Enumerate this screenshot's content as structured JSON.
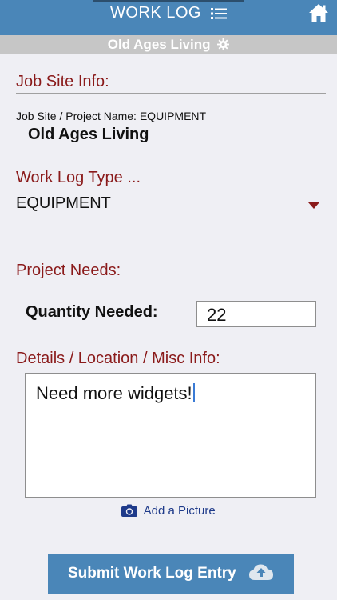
{
  "header": {
    "title": "WORK LOG",
    "subtitle": "Old Ages Living"
  },
  "job_site": {
    "section_title": "Job Site Info:",
    "label": "Job Site / Project Name: EQUIPMENT",
    "project_name": "Old Ages Living"
  },
  "work_log_type": {
    "section_title": "Work Log Type ...",
    "selected": "EQUIPMENT"
  },
  "project_needs": {
    "section_title": "Project Needs:",
    "quantity_label": "Quantity Needed:",
    "quantity_value": "22"
  },
  "details": {
    "section_title": "Details / Location / Misc Info:",
    "value": "Need more widgets!"
  },
  "actions": {
    "add_picture": "Add a Picture",
    "submit": "Submit Work Log Entry"
  },
  "colors": {
    "primary": "#4a86b8",
    "section_title": "#8a1a1a",
    "link": "#1e3a8a"
  }
}
